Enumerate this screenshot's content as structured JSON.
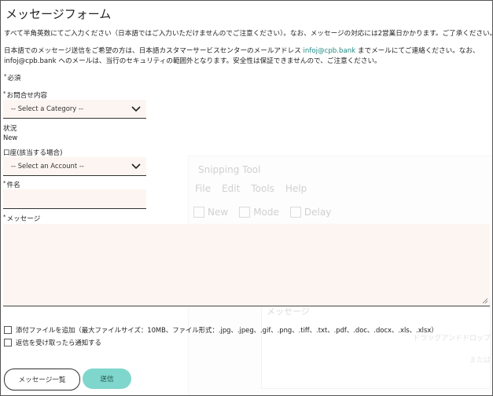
{
  "form": {
    "title": "メッセージフォーム",
    "intro": "すべて半角英数にてご入力ください（日本語ではご入力いただけませんのでご注意ください）。なお、メッセージの対応には2営業日かかります。ご了承ください。",
    "note_part1": "日本語でのメッセージ送信をご希望の方は、日本語カスタマーサービスセンターのメールアドレス",
    "note_email1": "infoj@cpb.bank",
    "note_part2": "までメールにてご連絡ください。なお、",
    "note_email2": "infoj@cpb.bank",
    "note_part3": "へのメールは、当行のセキュリティの範囲外となります。安全性は保証できませんので、ご注意ください。",
    "required_note": "必須",
    "asterisk": "*"
  },
  "fields": {
    "category": {
      "label": "お問合せ内容",
      "value": "-- Select a Category --"
    },
    "status": {
      "label": "状況",
      "value": "New"
    },
    "account": {
      "label": "口座(該当する場合)",
      "value": "-- Select an Account --"
    },
    "subject": {
      "label": "件名",
      "value": ""
    },
    "message": {
      "label": "メッセージ",
      "value": ""
    }
  },
  "options": {
    "attach": "添付ファイルを追加（最大ファイルサイズ：10MB、ファイル形式：.jpg、.jpeg、.gif、.png、.tiff、.txt、.pdf、.doc、.docx、.xls、.xlsx）",
    "notify": "返信を受け取ったら通知する"
  },
  "buttons": {
    "list": "メッセージ一覧",
    "send": "送信"
  },
  "ghost_window": {
    "title": "Snipping Tool",
    "menu": [
      "File",
      "Edit",
      "Tools",
      "Help"
    ],
    "new": "New",
    "mode": "Mode",
    "delay": "Delay",
    "inner_label": "メッセージ",
    "side1": "ドラッグアンドドロップ",
    "side2": "または"
  },
  "colors": {
    "accent": "#7fd6cc",
    "link": "#1f8a82",
    "field_bg": "#fdf5f1"
  }
}
